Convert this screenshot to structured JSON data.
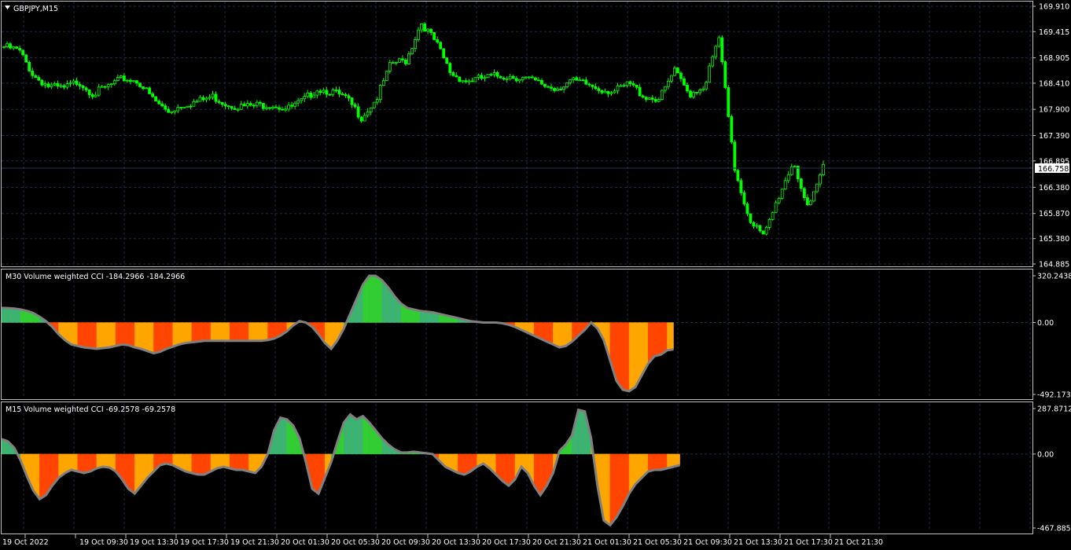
{
  "window": {
    "title": "GBPJPY,M15"
  },
  "colors": {
    "background": "#000000",
    "frame": "#c0c0c0",
    "grid": "#1f2a44",
    "candle": "#00ff00",
    "cci_line": "#808080",
    "cci_positive": "#3cb371",
    "cci_positive_strong": "#32cd32",
    "cci_negative": "#ffa500",
    "cci_negative_strong": "#ff4500",
    "current_price_bg": "#ffffff"
  },
  "main": {
    "price_labels": [
      "169.910",
      "169.415",
      "168.905",
      "168.410",
      "167.900",
      "167.390",
      "166.895",
      "166.380",
      "165.870",
      "165.380",
      "164.885"
    ],
    "current_price": "166.758"
  },
  "sub1": {
    "title": "M30 Volume weighted CCI -184.2966 -184.2966",
    "labels": [
      "320.2438",
      "0.00",
      "-492.1739"
    ]
  },
  "sub2": {
    "title": "M15 Volume weighted CCI -69.2578 -69.2578",
    "labels": [
      "287.8712",
      "0.00",
      "-467.8855"
    ]
  },
  "time_labels": [
    "19 Oct 2022",
    "19 Oct 09:30",
    "19 Oct 13:30",
    "19 Oct 17:30",
    "19 Oct 21:30",
    "20 Oct 01:30",
    "20 Oct 05:30",
    "20 Oct 09:30",
    "20 Oct 13:30",
    "20 Oct 17:30",
    "20 Oct 21:30",
    "21 Oct 01:30",
    "21 Oct 05:30",
    "21 Oct 09:30",
    "21 Oct 13:30",
    "21 Oct 17:30",
    "21 Oct 21:30"
  ],
  "chart_data": [
    {
      "type": "candlestick",
      "title": "GBPJPY,M15",
      "ylim": [
        164.885,
        169.91
      ],
      "x": [
        "19 Oct 2022",
        "19 Oct 09:30",
        "19 Oct 13:30",
        "19 Oct 17:30",
        "19 Oct 21:30",
        "20 Oct 01:30",
        "20 Oct 05:30",
        "20 Oct 09:30",
        "20 Oct 13:30",
        "20 Oct 17:30",
        "20 Oct 21:30",
        "21 Oct 01:30",
        "21 Oct 05:30",
        "21 Oct 09:30",
        "21 Oct 13:30",
        "21 Oct 17:30",
        "21 Oct 21:30"
      ],
      "close_path": [
        169.12,
        169.05,
        168.55,
        168.35,
        168.3,
        168.45,
        168.2,
        168.35,
        168.5,
        168.45,
        168.1,
        167.85,
        168.0,
        168.05,
        168.15,
        168.0,
        167.95,
        167.98,
        168.0,
        167.9,
        168.05,
        168.3,
        168.25,
        168.1,
        167.75,
        168.1,
        168.8,
        168.85,
        169.6,
        169.2,
        168.6,
        168.45,
        168.5,
        168.55,
        168.55,
        168.5,
        168.4,
        168.3,
        168.45,
        168.4,
        168.3,
        168.25,
        168.4,
        168.15,
        168.1,
        168.65,
        168.2,
        168.35,
        169.3,
        166.8,
        165.8,
        165.4,
        166.2,
        166.9,
        165.9,
        166.8
      ]
    },
    {
      "type": "area",
      "title": "M30 Volume weighted CCI -184.2966 -184.2966",
      "ylim": [
        -492.1739,
        320.2438
      ],
      "x": [
        0,
        2,
        4,
        6,
        8,
        10,
        12,
        14,
        16,
        18,
        20,
        22,
        24,
        26,
        28,
        30,
        32,
        34,
        36,
        38,
        40,
        42,
        44,
        46,
        48,
        50,
        52,
        54,
        56,
        58,
        60,
        62,
        64,
        66,
        68,
        70,
        72,
        74,
        76,
        78,
        80,
        82,
        84,
        86,
        88,
        90,
        92,
        94,
        96,
        98,
        100,
        102,
        104,
        106,
        108,
        110,
        112,
        114,
        116,
        118,
        120,
        122,
        124,
        126,
        128,
        130,
        132,
        134,
        136,
        138,
        140,
        142,
        144,
        146,
        148,
        150,
        152,
        154,
        156,
        158,
        160,
        162,
        164,
        166,
        168,
        170,
        172,
        174,
        176,
        178,
        180,
        182,
        184,
        186,
        188,
        190,
        192,
        194,
        196,
        198,
        200,
        202,
        204,
        206,
        208,
        210,
        212,
        214,
        216,
        218,
        220,
        222,
        224,
        226,
        228,
        230,
        232,
        234,
        236,
        238,
        240,
        242,
        244,
        246,
        248,
        250,
        252,
        254,
        256,
        258,
        260
      ],
      "values": [
        100,
        99,
        96,
        90,
        80,
        65,
        40,
        10,
        -30,
        -80,
        -120,
        -150,
        -160,
        -170,
        -175,
        -180,
        -175,
        -170,
        -160,
        -150,
        -155,
        -170,
        -180,
        -195,
        -210,
        -200,
        -180,
        -165,
        -150,
        -140,
        -135,
        -130,
        -125,
        -125,
        -125,
        -125,
        -125,
        -125,
        -125,
        -125,
        -125,
        -125,
        -120,
        -110,
        -90,
        -60,
        -20,
        10,
        0,
        -30,
        -80,
        -140,
        -180,
        -120,
        -40,
        60,
        160,
        260,
        320,
        320,
        290,
        240,
        180,
        130,
        100,
        90,
        80,
        75,
        70,
        60,
        50,
        40,
        30,
        20,
        10,
        5,
        0,
        0,
        0,
        -5,
        -15,
        -30,
        -50,
        -70,
        -90,
        -110,
        -130,
        -150,
        -170,
        -160,
        -130,
        -90,
        -50,
        0,
        -40,
        -120,
        -260,
        -400,
        -460,
        -470,
        -440,
        -360,
        -280,
        -230,
        -220,
        -190,
        -184
      ]
    },
    {
      "type": "area",
      "title": "M15 Volume weighted CCI -69.2578 -69.2578",
      "ylim": [
        -467.8855,
        287.8712
      ],
      "x": [
        0,
        2,
        4,
        6,
        8,
        10,
        12,
        14,
        16,
        18,
        20,
        22,
        24,
        26,
        28,
        30,
        32,
        34,
        36,
        38,
        40,
        42,
        44,
        46,
        48,
        50,
        52,
        54,
        56,
        58,
        60,
        62,
        64,
        66,
        68,
        70,
        72,
        74,
        76,
        78,
        80,
        82,
        84,
        86,
        88,
        90,
        92,
        94,
        96,
        98,
        100,
        102,
        104,
        106,
        108,
        110,
        112,
        114,
        116,
        118,
        120,
        122,
        124,
        126,
        128,
        130,
        132,
        134,
        136,
        138,
        140,
        142,
        144,
        146,
        148,
        150,
        152,
        154,
        156,
        158,
        160,
        162,
        164,
        166,
        168,
        170,
        172,
        174,
        176,
        178,
        180,
        182,
        184,
        186,
        188,
        190,
        192,
        194,
        196,
        198,
        200,
        202,
        204,
        206,
        208,
        210,
        212,
        214,
        216,
        218,
        220,
        222,
        224,
        226,
        228,
        230,
        232,
        234,
        236,
        238,
        240,
        242,
        244,
        246,
        248,
        250,
        252,
        254,
        256,
        258,
        260
      ],
      "values": [
        95,
        80,
        40,
        -40,
        -140,
        -230,
        -285,
        -260,
        -200,
        -150,
        -120,
        -100,
        -110,
        -120,
        -110,
        -90,
        -80,
        -85,
        -110,
        -160,
        -220,
        -250,
        -200,
        -150,
        -110,
        -70,
        -60,
        -70,
        -90,
        -110,
        -120,
        -130,
        -130,
        -110,
        -90,
        -80,
        -90,
        -100,
        -100,
        -110,
        -120,
        -80,
        0,
        150,
        230,
        220,
        180,
        100,
        -50,
        -220,
        -250,
        -150,
        -50,
        80,
        200,
        250,
        220,
        240,
        200,
        150,
        100,
        60,
        30,
        10,
        10,
        15,
        10,
        5,
        0,
        -40,
        -80,
        -100,
        -120,
        -130,
        -110,
        -80,
        -60,
        -90,
        -130,
        -170,
        -200,
        -160,
        -80,
        -120,
        -200,
        -260,
        -200,
        -120,
        20,
        60,
        120,
        280,
        270,
        100,
        -200,
        -420,
        -450,
        -400,
        -330,
        -250,
        -190,
        -150,
        -110,
        -100,
        -100,
        -90,
        -80,
        -69
      ]
    }
  ]
}
